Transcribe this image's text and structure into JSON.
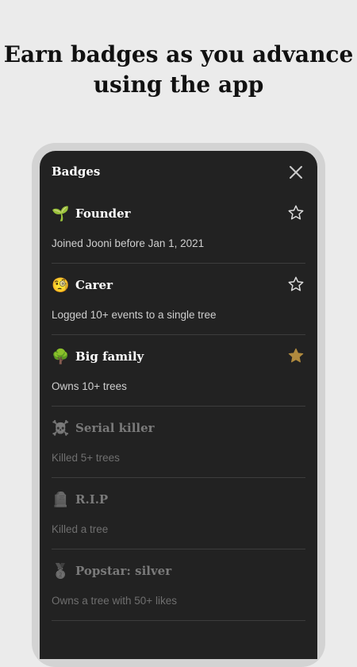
{
  "headline": "Earn badges as you advance using the app",
  "dialog": {
    "title": "Badges",
    "close_icon": "close-icon"
  },
  "colors": {
    "background": "#ebebeb",
    "frame": "#d3d3d3",
    "screen": "#222222",
    "star_active": "#b08a3e",
    "star_outline": "#dddddd"
  },
  "badges": [
    {
      "emoji": "🌱",
      "icon": "seedling-icon",
      "name": "Founder",
      "description": "Joined Jooni before Jan 1, 2021",
      "starred": false,
      "locked": false
    },
    {
      "emoji": "🧐",
      "icon": "monocle-face-icon",
      "name": "Carer",
      "description": "Logged 10+ events to a single tree",
      "starred": false,
      "locked": false
    },
    {
      "emoji": "🌳",
      "icon": "tree-icon",
      "name": "Big family",
      "description": "Owns 10+ trees",
      "starred": true,
      "locked": false
    },
    {
      "emoji": "☠️",
      "icon": "skull-crossbones-icon",
      "name": "Serial killer",
      "description": "Killed 5+ trees",
      "starred": false,
      "locked": true
    },
    {
      "emoji": "🪦",
      "icon": "headstone-icon",
      "name": "R.I.P",
      "description": "Killed a tree",
      "starred": false,
      "locked": true
    },
    {
      "emoji": "🥈",
      "icon": "silver-medal-icon",
      "name": "Popstar: silver",
      "description": "Owns a tree with 50+ likes",
      "starred": false,
      "locked": true
    }
  ]
}
